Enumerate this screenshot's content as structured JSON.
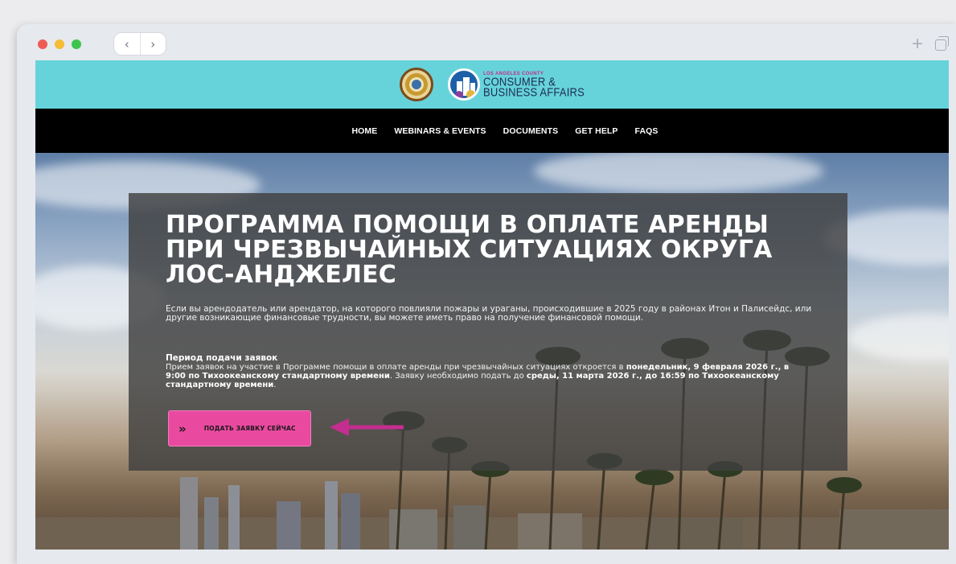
{
  "browser": {
    "back_glyph": "‹",
    "forward_glyph": "›",
    "new_tab_glyph": "+"
  },
  "header": {
    "dcba_logo_small": "LOS ANGELES COUNTY",
    "dcba_logo_line1": "CONSUMER &",
    "dcba_logo_line2": "BUSINESS AFFAIRS"
  },
  "nav": {
    "items": [
      "HOME",
      "WEBINARS & EVENTS",
      "DOCUMENTS",
      "GET HELP",
      "FAQS"
    ]
  },
  "hero": {
    "title": "ПРОГРАММА ПОМОЩИ В ОПЛАТЕ АРЕНДЫ ПРИ ЧРЕЗВЫЧАЙНЫХ СИТУАЦИЯХ ОКРУГА ЛОС-АНДЖЕЛЕС",
    "description": "Если вы арендодатель или арендатор, на которого повлияли пожары и ураганы, происходившие в 2025 году в районах Итон и Палисейдс, или другие возникающие финансовые трудности, вы можете иметь право на получение финансовой помощи.",
    "period_heading": "Период подачи заявок",
    "period_text_1": "Прием заявок на участие в Программе помощи в оплате аренды при чрезвычайных ситуациях откроется в ",
    "period_bold_1": "понедельник, 9 февраля 2026 г., в 9:00 по Тихоокеанскому стандартному времени",
    "period_text_2": ". Заявку необходимо подать до ",
    "period_bold_2": "среды, 11 марта 2026 г., до 16:59 по Тихоокеанскому стандартному времени",
    "period_text_3": ".",
    "apply_glyph": "»",
    "apply_label": "ПОДАТЬ ЗАЯВКУ СЕЙЧАС"
  },
  "colors": {
    "header_bg": "#66d3db",
    "nav_bg": "#000000",
    "button_pink": "#e94aa0",
    "arrow_magenta": "#c42e8e"
  }
}
